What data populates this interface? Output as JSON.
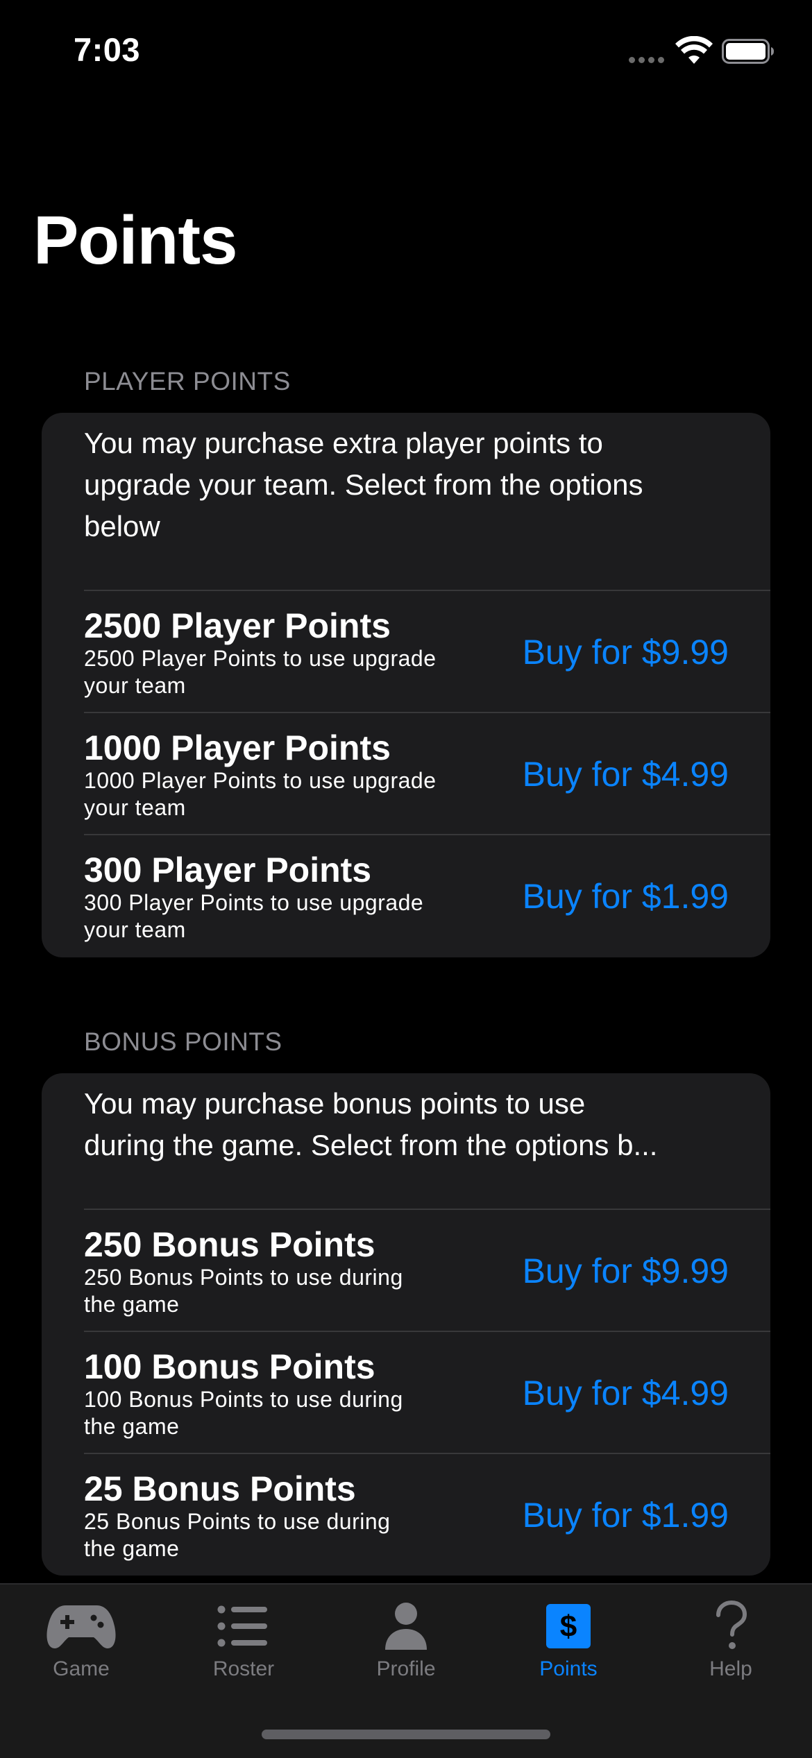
{
  "status_bar": {
    "time": "7:03"
  },
  "title": "Points",
  "sections": [
    {
      "header": "PLAYER POINTS",
      "intro_lines": [
        "You may purchase extra player points to",
        "upgrade your team. Select from the options",
        "below"
      ],
      "items": [
        {
          "title": "2500 Player Points",
          "desc_lines": [
            "2500 Player Points to use upgrade",
            "your team"
          ],
          "button": "Buy for $9.99"
        },
        {
          "title": "1000 Player Points",
          "desc_lines": [
            "1000 Player Points to use upgrade",
            "your team"
          ],
          "button": "Buy for $4.99"
        },
        {
          "title": "300 Player Points",
          "desc_lines": [
            "300 Player Points to use upgrade",
            "your team"
          ],
          "button": "Buy for $1.99"
        }
      ]
    },
    {
      "header": "BONUS POINTS",
      "intro_lines": [
        "You may purchase bonus points to use",
        "during the game. Select from the options b..."
      ],
      "items": [
        {
          "title": "250 Bonus Points",
          "desc_lines": [
            "250 Bonus Points to use during",
            "the game"
          ],
          "button": "Buy for $9.99"
        },
        {
          "title": "100 Bonus Points",
          "desc_lines": [
            "100 Bonus Points to use during",
            "the game"
          ],
          "button": "Buy for $4.99"
        },
        {
          "title": "25 Bonus Points",
          "desc_lines": [
            "25 Bonus Points to use during",
            "the game"
          ],
          "button": "Buy for $1.99"
        }
      ]
    }
  ],
  "tab_bar": {
    "items": [
      {
        "label": "Game",
        "icon": "gamecontroller-icon",
        "active": false
      },
      {
        "label": "Roster",
        "icon": "list-icon",
        "active": false
      },
      {
        "label": "Profile",
        "icon": "person-icon",
        "active": false
      },
      {
        "label": "Points",
        "icon": "dollar-sign-icon",
        "active": true
      },
      {
        "label": "Help",
        "icon": "question-mark-icon",
        "active": false
      }
    ]
  },
  "colors": {
    "background": "#000000",
    "card": "#1c1c1e",
    "accent": "#0a84ff",
    "secondary_text": "#8d8d93",
    "separator": "#38383a",
    "tab_inactive": "#7c7c80"
  }
}
